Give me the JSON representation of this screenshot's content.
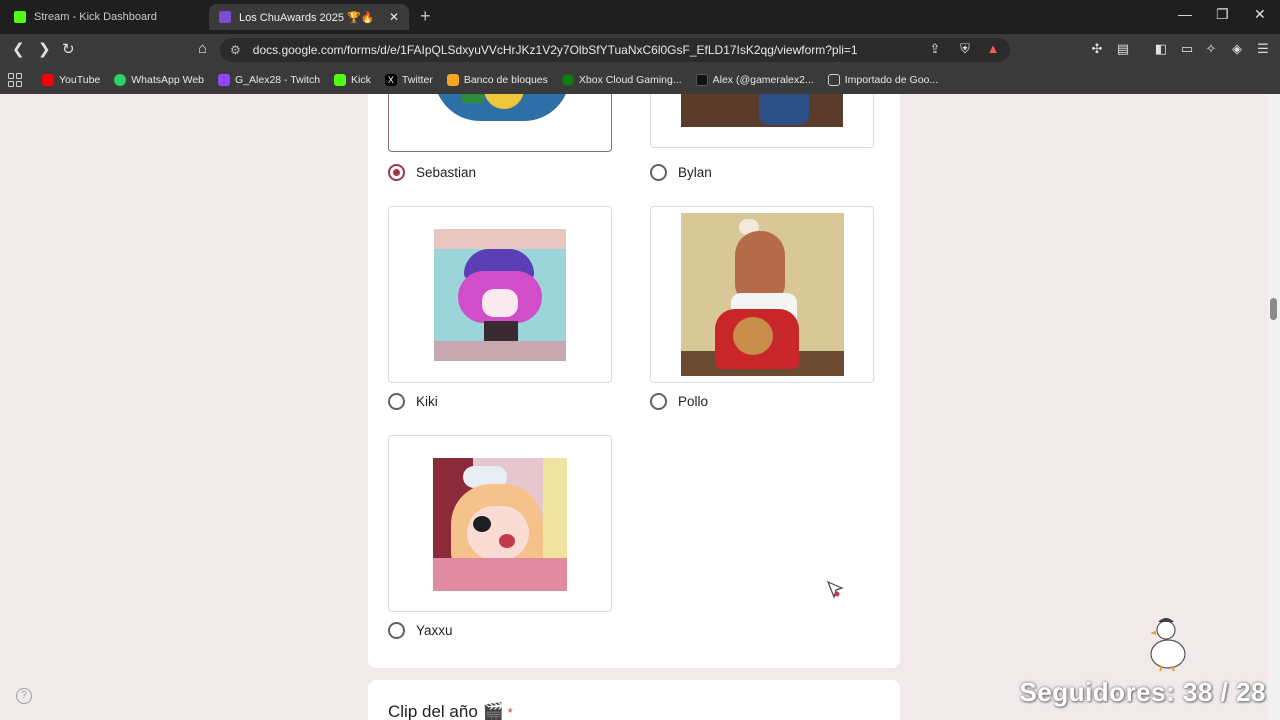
{
  "tabs": [
    {
      "title": "Stream - Kick Dashboard",
      "icon": "kick-icon"
    },
    {
      "title": "Los ChuAwards 2025 🏆🔥",
      "icon": "forms-icon"
    }
  ],
  "toolbar": {
    "url": "docs.google.com/forms/d/e/1FAIpQLSdxyuVVcHrJKz1V2y7OlbSfYTuaNxC6l0GsF_EfLD17IsK2qg/viewform?pli=1"
  },
  "bookmarks": [
    {
      "label": "YouTube",
      "color": "#ff0000"
    },
    {
      "label": "WhatsApp Web",
      "color": "#25d366"
    },
    {
      "label": "G_Alex28 - Twitch",
      "color": "#9146ff"
    },
    {
      "label": "Kick",
      "color": "#53fc18"
    },
    {
      "label": "Twitter",
      "color": "#000000"
    },
    {
      "label": "Banco de bloques",
      "color": "#f5a623"
    },
    {
      "label": "Xbox Cloud Gaming...",
      "color": "#107c10"
    },
    {
      "label": "Alex (@gameralex2...",
      "color": "#111111"
    },
    {
      "label": "Importado de Goo...",
      "color": "#cfcfcf"
    }
  ],
  "form": {
    "options": [
      {
        "label": "Sebastian",
        "selected": true
      },
      {
        "label": "Bylan",
        "selected": false
      },
      {
        "label": "Kiki",
        "selected": false
      },
      {
        "label": "Pollo",
        "selected": false
      },
      {
        "label": "Yaxxu",
        "selected": false
      }
    ],
    "next_question": "Clip del año 🎬",
    "required_mark": "*"
  },
  "overlay": {
    "followers": "Seguidores: 38 / 28"
  },
  "colors": {
    "page_bg": "#f2e9ea",
    "accent": "#9c3a4b"
  }
}
